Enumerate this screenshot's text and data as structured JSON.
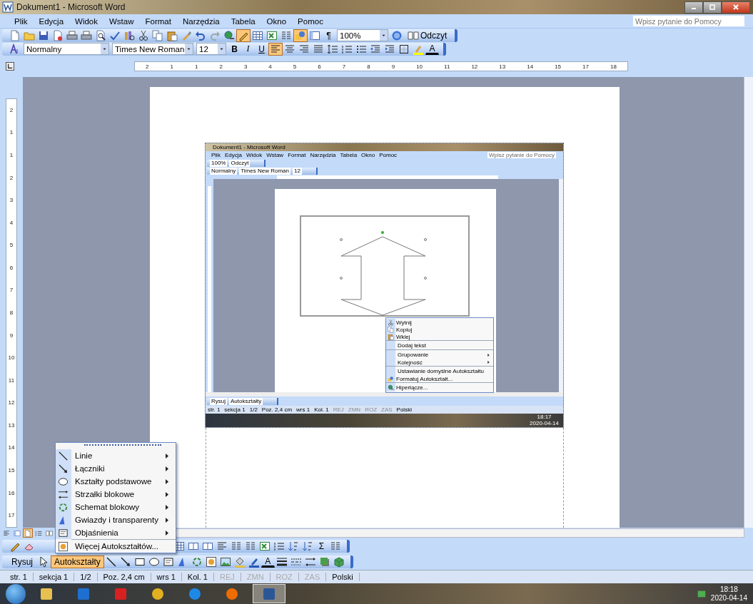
{
  "window": {
    "title": "Dokument1 - Microsoft Word"
  },
  "menu_bar": {
    "items": [
      "Plik",
      "Edycja",
      "Widok",
      "Wstaw",
      "Format",
      "Narzędzia",
      "Tabela",
      "Okno",
      "Pomoc"
    ],
    "help_search": {
      "placeholder": "Wpisz pytanie do Pomocy"
    }
  },
  "standard_toolbar": {
    "toggle_buttons": [
      {
        "selected": true
      },
      {
        "selected": false
      },
      {
        "selected": false
      },
      {
        "selected": false
      },
      {
        "selected": true
      }
    ],
    "pilcrow": "¶",
    "zoom": "100%",
    "reading_button": "Odczyt"
  },
  "formatting_toolbar": {
    "style": "Normalny",
    "font": "Times New Roman",
    "size": "12",
    "bold": "B",
    "italic": "I",
    "underline": "U",
    "alignment": [
      {
        "selected": true
      },
      {
        "selected": false
      },
      {
        "selected": false
      },
      {
        "selected": false
      }
    ],
    "font_color": "A"
  },
  "ruler": {
    "labels": [
      "2",
      "1",
      "1",
      "2",
      "3",
      "4",
      "5",
      "6",
      "7",
      "8",
      "9",
      "10",
      "11",
      "12",
      "13",
      "14",
      "15",
      "17",
      "18"
    ]
  },
  "vertical_ruler": {
    "labels": [
      "2",
      "1",
      "1",
      "2",
      "3",
      "4",
      "5",
      "6",
      "7",
      "8",
      "9",
      "10",
      "11",
      "12",
      "13",
      "14",
      "15",
      "16",
      "17"
    ]
  },
  "embedded_screenshot": {
    "title": "Dokument1 - Microsoft Word",
    "menu_items": [
      "Plik",
      "Edycja",
      "Widok",
      "Wstaw",
      "Format",
      "Narzędzia",
      "Tabela",
      "Okno",
      "Pomoc"
    ],
    "help_placeholder": "Wpisz pytanie do Pomocy",
    "zoom": "100%",
    "reading_button": "Odczyt",
    "style": "Normalny",
    "font": "Times New Roman",
    "size": "12",
    "context_menu": [
      {
        "label": "Wytnij",
        "separator_before": false,
        "submenu": false
      },
      {
        "label": "Kopiuj",
        "separator_before": false,
        "submenu": false
      },
      {
        "label": "Wklej",
        "separator_before": false,
        "submenu": false
      },
      {
        "label": "Dodaj tekst",
        "separator_before": true,
        "submenu": false
      },
      {
        "label": "Grupowanie",
        "separator_before": true,
        "submenu": true
      },
      {
        "label": "Kolejność",
        "separator_before": false,
        "submenu": true
      },
      {
        "label": "Ustawianie domyślne Autokształtu",
        "separator_before": true,
        "submenu": false
      },
      {
        "label": "Formatuj Autokształt...",
        "separator_before": false,
        "submenu": false
      },
      {
        "label": "Hiperłącze...",
        "separator_before": true,
        "submenu": false
      }
    ],
    "draw": "Rysuj",
    "autoshapes": "Autokształty",
    "status_fields": [
      {
        "text": "str. 1",
        "disabled": false
      },
      {
        "text": "sekcja 1",
        "disabled": false
      },
      {
        "text": "1/2",
        "disabled": false
      },
      {
        "text": "Poz. 2,4 cm",
        "disabled": false
      },
      {
        "text": "wrs 1",
        "disabled": false
      },
      {
        "text": "Kol. 1",
        "disabled": false
      },
      {
        "text": "REJ",
        "disabled": true
      },
      {
        "text": "ZMN",
        "disabled": true
      },
      {
        "text": "ROZ",
        "disabled": true
      },
      {
        "text": "ZAS",
        "disabled": true
      },
      {
        "text": "Polski",
        "disabled": false
      }
    ],
    "time": "18:17",
    "date": "2020-04-14"
  },
  "autoshapes_menu": {
    "items": [
      {
        "label": "Linie",
        "submenu": true,
        "separator_before": false
      },
      {
        "label": "Łączniki",
        "submenu": true,
        "separator_before": false
      },
      {
        "label": "Kształty podstawowe",
        "submenu": true,
        "separator_before": false
      },
      {
        "label": "Strzałki blokowe",
        "submenu": true,
        "separator_before": false
      },
      {
        "label": "Schemat blokowy",
        "submenu": true,
        "separator_before": false
      },
      {
        "label": "Gwiazdy i transparenty",
        "submenu": true,
        "separator_before": false
      },
      {
        "label": "Objaśnienia",
        "submenu": true,
        "separator_before": false
      },
      {
        "label": "Więcej Autokształtów...",
        "submenu": false,
        "separator_before": true
      }
    ]
  },
  "view_buttons": [
    {
      "selected": false
    },
    {
      "selected": false
    },
    {
      "selected": true
    },
    {
      "selected": false
    },
    {
      "selected": false
    }
  ],
  "tables_toolbar": {
    "sum": "Σ"
  },
  "drawing_toolbar": {
    "draw": "Rysuj",
    "autoshapes": {
      "label": "Autokształty",
      "selected": true
    },
    "font_color": "A"
  },
  "status_bar": {
    "fields": [
      {
        "text": "str. 1",
        "disabled": false
      },
      {
        "text": "sekcja 1",
        "disabled": false
      },
      {
        "text": "1/2",
        "disabled": false
      },
      {
        "text": "Poz. 2,4 cm",
        "disabled": false
      },
      {
        "text": "wrs 1",
        "disabled": false
      },
      {
        "text": "Kol. 1",
        "disabled": false
      },
      {
        "text": "REJ",
        "disabled": true
      },
      {
        "text": "ZMN",
        "disabled": true
      },
      {
        "text": "ROZ",
        "disabled": true
      },
      {
        "text": "ZAS",
        "disabled": true
      },
      {
        "text": "Polski",
        "disabled": false
      }
    ]
  },
  "taskbar": {
    "apps": [
      {
        "selected": false
      },
      {
        "selected": false
      },
      {
        "selected": false
      },
      {
        "selected": false
      },
      {
        "selected": false
      },
      {
        "selected": false
      },
      {
        "selected": true
      }
    ],
    "time": "18:18",
    "date": "2020-04-14"
  }
}
